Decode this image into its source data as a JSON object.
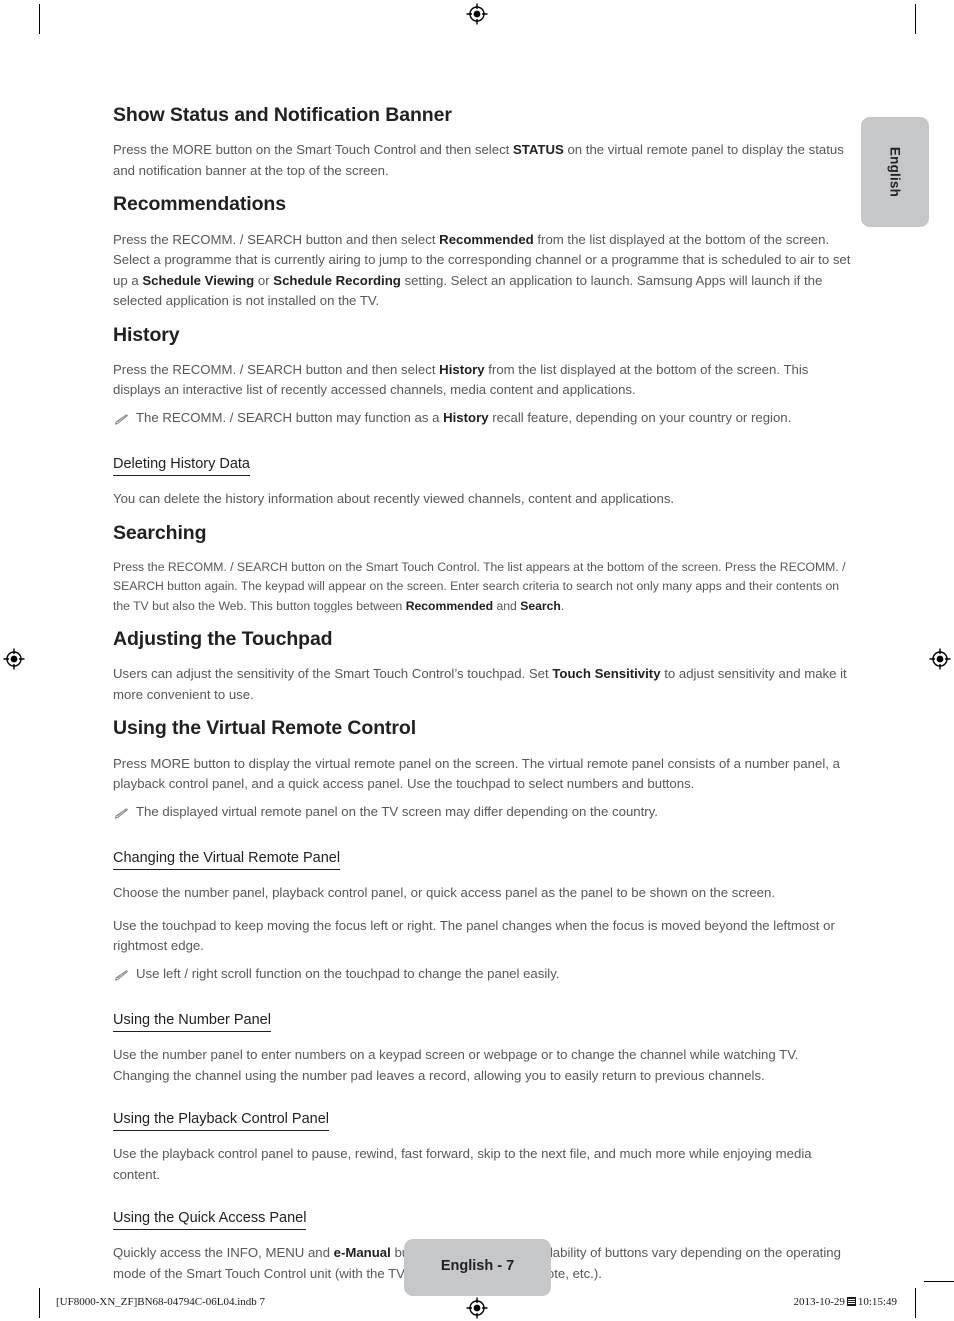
{
  "document": {
    "language_tab": "English",
    "page_badge": "English - 7"
  },
  "sections": [
    {
      "id": "show-status",
      "heading": "Show Status and Notification Banner",
      "paragraph_parts": [
        {
          "t": "Press the ",
          "b": false
        },
        {
          "t": "MORE",
          "b": false,
          "kw": true
        },
        {
          "t": " button on the Smart Touch Control and then select ",
          "b": false
        },
        {
          "t": "STATUS",
          "b": true
        },
        {
          "t": " on the virtual remote panel to display the status and notification banner at the top of the screen.",
          "b": false
        }
      ]
    },
    {
      "id": "recommendations",
      "heading": "Recommendations"
    },
    {
      "id": "history",
      "heading": "History",
      "note": "The RECOMM. / SEARCH button may function as a History recall feature, depending on your country or region."
    },
    {
      "id": "deleting-history-data",
      "heading": "Deleting History Data",
      "paragraph": "You can delete the history information about recently viewed channels, content and applications."
    },
    {
      "id": "searching",
      "heading": "Searching"
    },
    {
      "id": "adjusting-the-touchpad",
      "heading": "Adjusting the Touchpad"
    },
    {
      "id": "using-the-virtual-remote-control",
      "heading": "Using the Virtual Remote Control",
      "note": "The displayed virtual remote panel on the TV screen may differ depending on the country."
    },
    {
      "id": "changing-the-virtual-remote-panel",
      "heading": "Changing the Virtual Remote Panel",
      "note": "Use left / right scroll function on the touchpad to change the panel easily."
    },
    {
      "id": "using-the-number-panel",
      "heading": "Using the Number Panel"
    },
    {
      "id": "using-the-playback-control-panel",
      "heading": "Using the Playback Control Panel"
    },
    {
      "id": "using-the-quick-access-panel",
      "heading": "Using the Quick Access Panel"
    }
  ],
  "body": {
    "show_status_p1_a": "Press the ",
    "show_status_p1_more": "MORE",
    "show_status_p1_b": " button on the Smart Touch Control and then select ",
    "show_status_p1_status": "STATUS",
    "show_status_p1_c": " on the virtual remote panel to display the status and notification banner at the top of the screen.",
    "recommendations_a": "Press the ",
    "recommendations_recomm": "RECOMM. / SEARCH",
    "recommendations_b": " button and then select ",
    "recommendations_recommended": "Recommended",
    "recommendations_c": " from the list displayed at the bottom of the screen. Select a programme that is currently airing to jump to the corresponding channel or a programme that is scheduled to air to set up a ",
    "recommendations_schedule_viewing": "Schedule Viewing",
    "recommendations_d": " or ",
    "recommendations_schedule_recording": "Schedule Recording",
    "recommendations_e": " setting. Select an application to launch. Samsung Apps will launch if the selected application is not installed on the TV.",
    "history_a": "Press the ",
    "history_recomm": "RECOMM. / SEARCH",
    "history_b": " button and then select ",
    "history_history": "History",
    "history_c": " from the list displayed at the bottom of the screen. This displays an interactive list of recently accessed channels, media content and applications.",
    "history_note_a": "The ",
    "history_note_recomm": "RECOMM. / SEARCH",
    "history_note_b": " button may function as a ",
    "history_note_history": "History",
    "history_note_c": " recall feature, depending on your country or region.",
    "deleting_history": "You can delete the history information about recently viewed channels, content and applications.",
    "searching_a": "Press the ",
    "searching_recomm1": "RECOMM. / SEARCH",
    "searching_b": " button on the Smart Touch Control. The list appears at the bottom of the screen. Press the ",
    "searching_recomm2": "RECOMM. / SEARCH",
    "searching_c": " button again. The keypad will appear on the screen. Enter search criteria to search not only many apps and their contents on the TV but also the Web. This button toggles between ",
    "searching_recommended": "Recommended",
    "searching_d": " and ",
    "searching_search": "Search",
    "searching_e": ".",
    "touchpad_a": "Users can adjust the sensitivity of the Smart Touch Control’s touchpad. Set ",
    "touchpad_sensitivity": "Touch Sensitivity",
    "touchpad_b": " to adjust sensitivity and make it more convenient to use.",
    "virtual_remote_a": "Press ",
    "virtual_remote_more": "MORE",
    "virtual_remote_b": " button to display the virtual remote panel on the screen. The virtual remote panel consists of a number panel, a playback control panel, and a quick access panel. Use the touchpad to select numbers and buttons.",
    "virtual_remote_note": "The displayed virtual remote panel on the TV screen may differ depending on the country.",
    "changing_panel_p1": "Choose the number panel, playback control panel, or quick access panel as the panel to be shown on the screen.",
    "changing_panel_p2": "Use the touchpad to keep moving the focus left or right. The panel changes when the focus is moved beyond the leftmost or rightmost edge.",
    "changing_panel_note": "Use left / right scroll function on the touchpad to change the panel easily.",
    "number_panel": "Use the number panel to enter numbers on a keypad screen or webpage or to change the channel while watching TV. Changing the channel using the number pad leaves a record, allowing you to easily return to previous channels.",
    "playback_panel": "Use the playback control panel to pause, rewind, fast forward, skip to the next file, and much more while enjoying media content.",
    "quick_access_a": "Quickly access the ",
    "quick_access_info": "INFO",
    "quick_access_comma": ", ",
    "quick_access_menu": "MENU",
    "quick_access_b": " and ",
    "quick_access_emanual": "e-Manual",
    "quick_access_c": " buttons. However, the availability of buttons vary depending on the operating mode of the Smart Touch Control unit (with the TV only, as a universal remote, etc.)."
  },
  "imposition": {
    "file_reference": "[UF8000-XN_ZF]BN68-04794C-06L04.indb   7",
    "date": "2013-10-29",
    "time": "10:15:49"
  },
  "colors": {
    "heading": "#221f20",
    "body_text": "#58585a",
    "tab_gray": "#c6c7c9",
    "page_background": "#ffffff"
  },
  "icons": {
    "note_marker": "pencil-icon",
    "registration": "registration-mark-icon",
    "crop": "crop-mark-icon"
  }
}
